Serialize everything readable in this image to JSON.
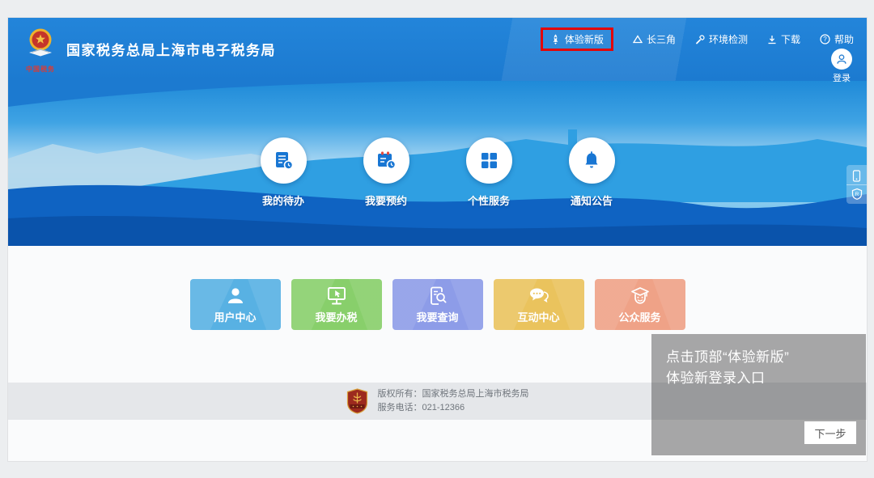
{
  "page": {
    "header": {
      "logo_icon": "china-tax-emblem-icon",
      "logo_caption": "中国税务",
      "title": "国家税务总局上海市电子税务局",
      "nav": [
        {
          "label": "体验新版",
          "icon": "rocket-icon",
          "highlighted": true
        },
        {
          "label": "长三角",
          "icon": "delta-triangle-icon",
          "highlighted": false
        },
        {
          "label": "环境检测",
          "icon": "wrench-icon",
          "highlighted": false
        },
        {
          "label": "下载",
          "icon": "download-icon",
          "highlighted": false
        },
        {
          "label": "帮助",
          "icon": "help-circle-icon",
          "highlighted": false
        }
      ],
      "login_label": "登录",
      "login_icon": "person-icon",
      "header_color": "#1f7fd4",
      "highlight_box_color": "#e30505"
    },
    "banner": {
      "quick_links": [
        {
          "label": "我的待办",
          "icon": "todo-document-clock-icon"
        },
        {
          "label": "我要预约",
          "icon": "calendar-clock-icon"
        },
        {
          "label": "个性服务",
          "icon": "apps-grid-icon"
        },
        {
          "label": "通知公告",
          "icon": "bell-icon"
        }
      ],
      "side_widget": [
        {
          "icon": "mobile-phone-icon"
        },
        {
          "icon": "shield-r-icon"
        }
      ]
    },
    "tiles": [
      {
        "label": "用户中心",
        "icon": "user-icon",
        "color": "#58b1e3"
      },
      {
        "label": "我要办税",
        "icon": "monitor-cursor-icon",
        "color": "#88cf6b"
      },
      {
        "label": "我要查询",
        "icon": "doc-search-icon",
        "color": "#8d9ce8"
      },
      {
        "label": "互动中心",
        "icon": "chat-bubbles-icon",
        "color": "#eac35d"
      },
      {
        "label": "公众服务",
        "icon": "graduate-icon",
        "color": "#efa287"
      }
    ],
    "footer": {
      "badge_icon": "red-shield-badge-icon",
      "copyright": "版权所有：国家税务总局上海市税务局",
      "phone": "服务电话：021-12366"
    },
    "tour": {
      "line1": "点击顶部“体验新版”",
      "line2": "体验新登录入口",
      "next_label": "下一步"
    }
  }
}
